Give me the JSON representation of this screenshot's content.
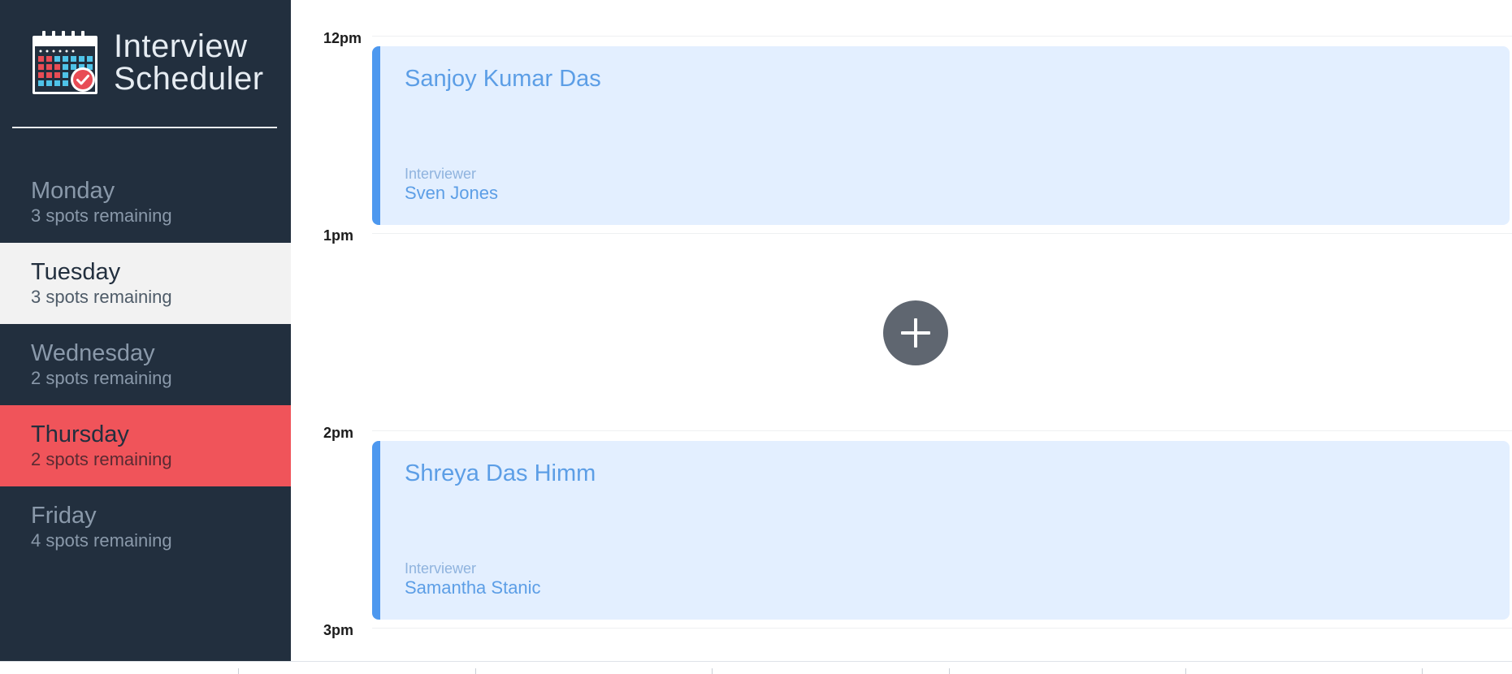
{
  "app": {
    "title_line1": "Interview",
    "title_line2": "Scheduler",
    "logo_icon": "calendar-check-icon"
  },
  "sidebar": {
    "days": [
      {
        "name": "Monday",
        "spots": "3 spots remaining",
        "state": "normal"
      },
      {
        "name": "Tuesday",
        "spots": "3 spots remaining",
        "state": "selected"
      },
      {
        "name": "Wednesday",
        "spots": "2 spots remaining",
        "state": "normal"
      },
      {
        "name": "Thursday",
        "spots": "2 spots remaining",
        "state": "highlight"
      },
      {
        "name": "Friday",
        "spots": "4 spots remaining",
        "state": "normal"
      }
    ]
  },
  "schedule": {
    "times": [
      "12pm",
      "1pm",
      "2pm",
      "3pm"
    ],
    "appointments": [
      {
        "student": "Sanjoy Kumar Das",
        "interviewer_label": "Interviewer",
        "interviewer": "Sven Jones"
      },
      {
        "student": "Shreya Das Himm",
        "interviewer_label": "Interviewer",
        "interviewer": "Samantha Stanic"
      }
    ],
    "add_icon": "plus-icon"
  },
  "colors": {
    "sidebar_bg": "#222f3e",
    "selected_bg": "#f2f2f2",
    "highlight_bg": "#f0545a",
    "appointment_bg": "#e3efff",
    "appointment_accent": "#4d98ef",
    "add_button_bg": "#5f6670"
  }
}
